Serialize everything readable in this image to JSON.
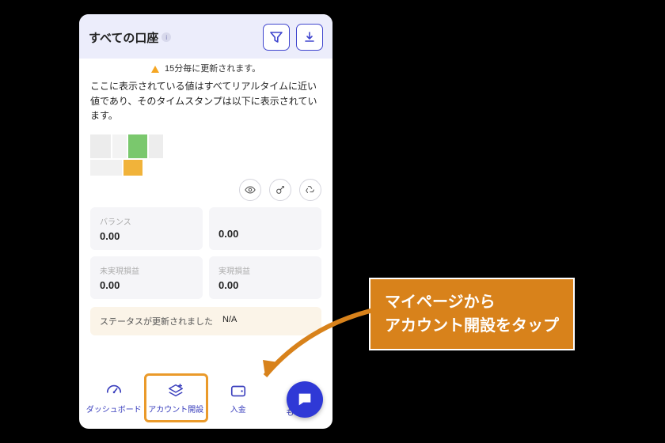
{
  "header": {
    "title": "すべての口座"
  },
  "refresh": {
    "text": "15分毎に更新されます。"
  },
  "description": "ここに表示されている値はすべてリアルタイムに近い値であり、そのタイムスタンプは以下に表示されています。",
  "cards": {
    "balance_label": "バランス",
    "balance_value": "0.00",
    "blank_label": "",
    "blank_value": "0.00",
    "unrealized_label": "未実現損益",
    "unrealized_value": "0.00",
    "realized_label": "実現損益",
    "realized_value": "0.00"
  },
  "status": {
    "label": "ステータスが更新されました",
    "value": "N/A"
  },
  "nav": {
    "dashboard": "ダッシュボード",
    "open_account": "アカウント開設",
    "deposit": "入金",
    "more": "もっと"
  },
  "callout": {
    "line1": "マイページから",
    "line2": "アカウント開設をタップ"
  },
  "colors": {
    "accent": "#3a3fbd",
    "highlight": "#ea9a2a",
    "callout_bg": "#D8821B"
  }
}
